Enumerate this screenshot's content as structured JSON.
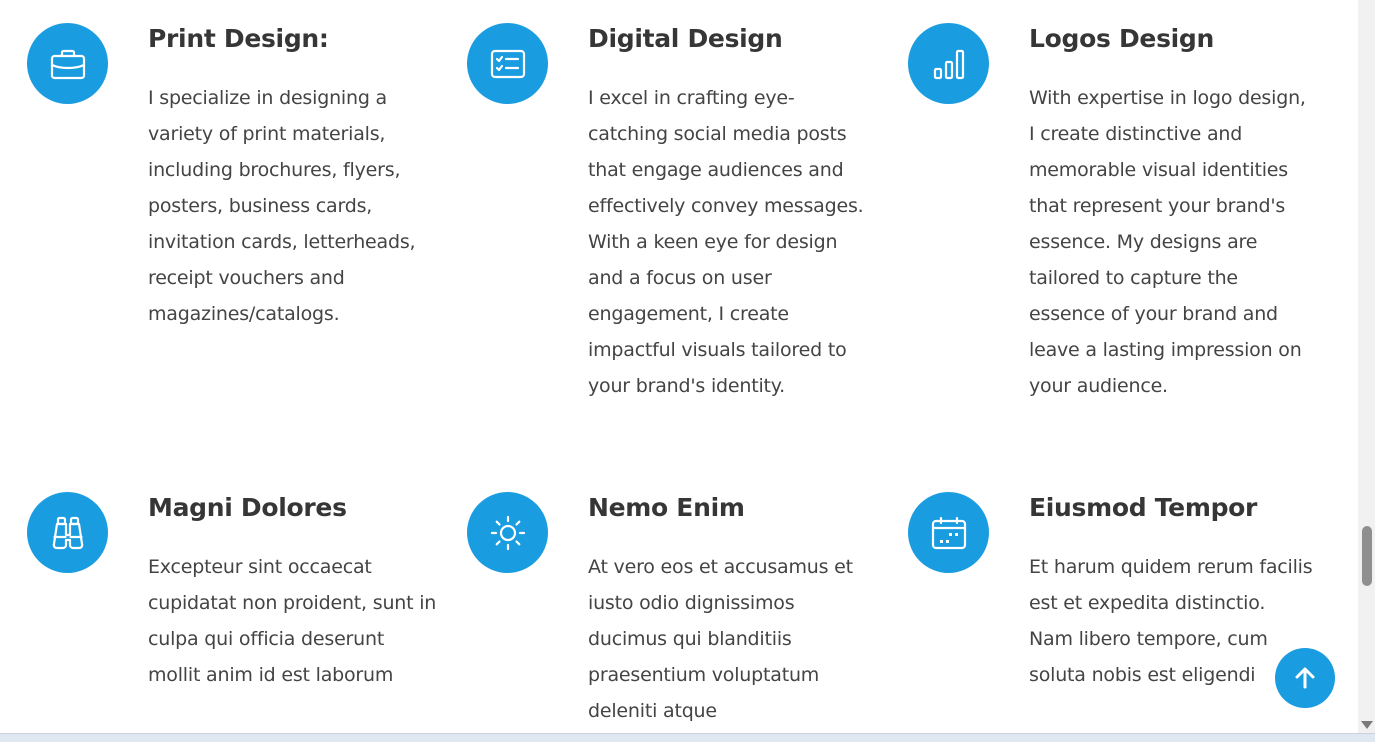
{
  "services": [
    {
      "title": "Print Design:",
      "icon": "briefcase-icon",
      "description": "I specialize in designing a variety of print materials, including brochures, flyers, posters, business cards, invitation cards, letterheads, receipt vouchers and magazines/catalogs."
    },
    {
      "title": "Digital Design",
      "icon": "checklist-card-icon",
      "description": "I excel in crafting eye-catching social media posts that engage audiences and effectively convey messages. With a keen eye for design and a focus on user engagement, I create impactful visuals tailored to your brand's identity."
    },
    {
      "title": "Logos Design",
      "icon": "bar-chart-icon",
      "description": "With expertise in logo design, I create distinctive and memorable visual identities that represent your brand's essence. My designs are tailored to capture the essence of your brand and leave a lasting impression on your audience."
    },
    {
      "title": "Magni Dolores",
      "icon": "binoculars-icon",
      "description": "Excepteur sint occaecat cupidatat non proident, sunt in culpa qui officia deserunt mollit anim id est laborum"
    },
    {
      "title": "Nemo Enim",
      "icon": "sun-icon",
      "description": "At vero eos et accusamus et iusto odio dignissimos ducimus qui blanditiis praesentium voluptatum deleniti atque"
    },
    {
      "title": "Eiusmod Tempor",
      "icon": "calendar-icon",
      "description": "Et harum quidem rerum facilis est et expedita distinctio. Nam libero tempore, cum soluta nobis est eligendi"
    }
  ],
  "back_to_top": {
    "icon": "arrow-up-icon"
  },
  "colors": {
    "accent": "#1a9ce0",
    "heading": "#363636",
    "text": "#444444"
  }
}
